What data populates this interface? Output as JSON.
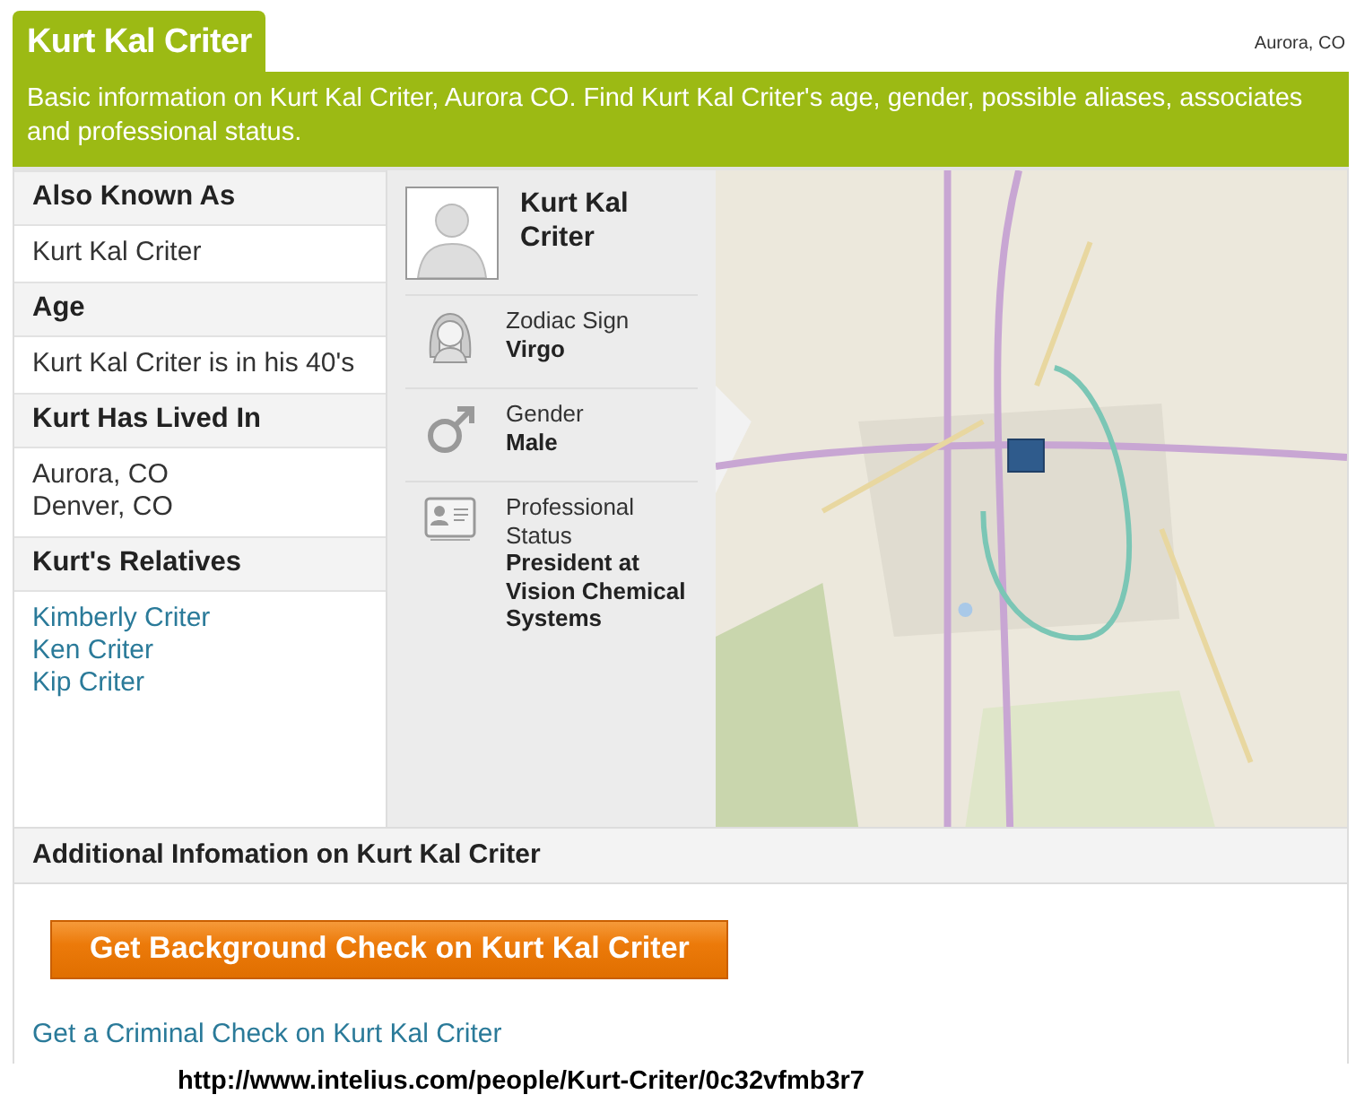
{
  "header": {
    "name": "Kurt Kal Criter",
    "location": "Aurora, CO",
    "summary": "Basic information on Kurt Kal Criter, Aurora CO. Find Kurt Kal Criter's age, gender, possible aliases, associates and professional status."
  },
  "sections": [
    {
      "title": "Also Known As",
      "kind": "text",
      "lines": [
        "Kurt Kal Criter"
      ]
    },
    {
      "title": "Age",
      "kind": "text",
      "lines": [
        "Kurt Kal Criter is in his 40's"
      ]
    },
    {
      "title": "Kurt Has Lived In",
      "kind": "text",
      "lines": [
        "Aurora, CO",
        "Denver, CO"
      ]
    },
    {
      "title": "Kurt's Relatives",
      "kind": "links",
      "lines": [
        "Kimberly Criter",
        "Ken Criter",
        "Kip Criter"
      ]
    }
  ],
  "profile": {
    "name": "Kurt Kal Criter",
    "facts": [
      {
        "kind": "zodiac",
        "label": "Zodiac Sign",
        "value": "Virgo"
      },
      {
        "kind": "gender",
        "label": "Gender",
        "value": "Male"
      },
      {
        "kind": "profession",
        "label": "Professional Status",
        "value": "President at Vision Chemical Systems"
      }
    ]
  },
  "additional": {
    "title": "Additional Infomation on Kurt Kal Criter",
    "button": "Get Background Check on Kurt Kal Criter",
    "link": "Get a Criminal Check on Kurt Kal Criter"
  },
  "url": "http://www.intelius.com/people/Kurt-Criter/0c32vfmb3r7"
}
